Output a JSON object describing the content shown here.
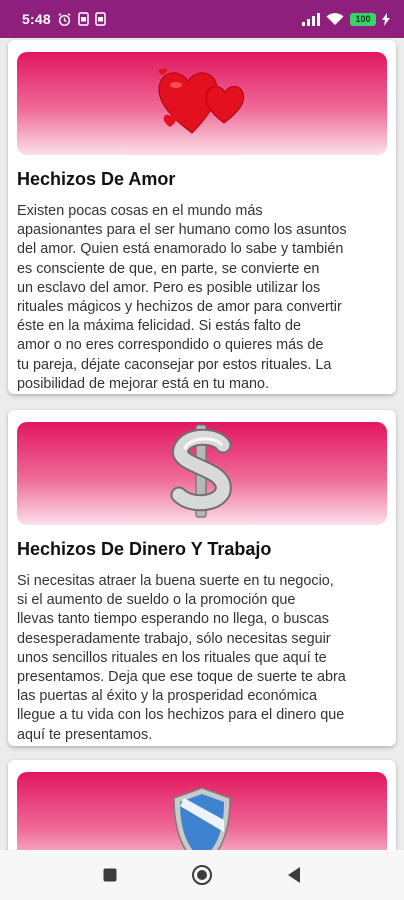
{
  "status_bar": {
    "time": "5:48",
    "battery": "100",
    "icons": [
      "alarm-icon",
      "sim-icon",
      "sim-icon",
      "signal-icon",
      "wifi-icon",
      "battery-icon",
      "charging-icon"
    ]
  },
  "colors": {
    "status_bar": "#8e1f7c",
    "banner_top": "#e2165f",
    "banner_bottom": "#fbe0ea"
  },
  "cards": [
    {
      "icon": "hearts-icon",
      "title": "Hechizos De Amor",
      "lines": [
        "Existen pocas cosas en el mundo más",
        "apasionantes para el ser humano como los asuntos",
        "del amor. Quien está enamorado lo sabe y también",
        "es consciente de que, en parte, se convierte en",
        "un esclavo del amor. Pero es posible utilizar los",
        "rituales mágicos y hechizos de amor para convertir",
        "éste en la máxima felicidad. Si estás falto de",
        "amor o no eres correspondido o quieres más de",
        "tu pareja, déjate caconsejar por estos rituales. La",
        "posibilidad de mejorar está en tu mano."
      ]
    },
    {
      "icon": "dollar-sign-icon",
      "title": "Hechizos De Dinero Y Trabajo",
      "lines": [
        "Si necesitas atraer la buena suerte en tu negocio,",
        "si el aumento de sueldo o la promoción que",
        "llevas tanto tiempo esperando no llega, o buscas",
        "desesperadamente trabajo, sólo necesitas seguir",
        "unos sencillos rituales en los rituales que aquí te",
        "presentamos. Deja que ese toque de suerte te abra",
        "las puertas al éxito y la prosperidad económica",
        "llegue a tu vida con los hechizos para el dinero que",
        "aquí te presentamos."
      ]
    },
    {
      "icon": "shield-icon"
    }
  ],
  "nav_bar": {
    "buttons": [
      "recents-square-icon",
      "home-circle-icon",
      "back-triangle-icon"
    ]
  }
}
